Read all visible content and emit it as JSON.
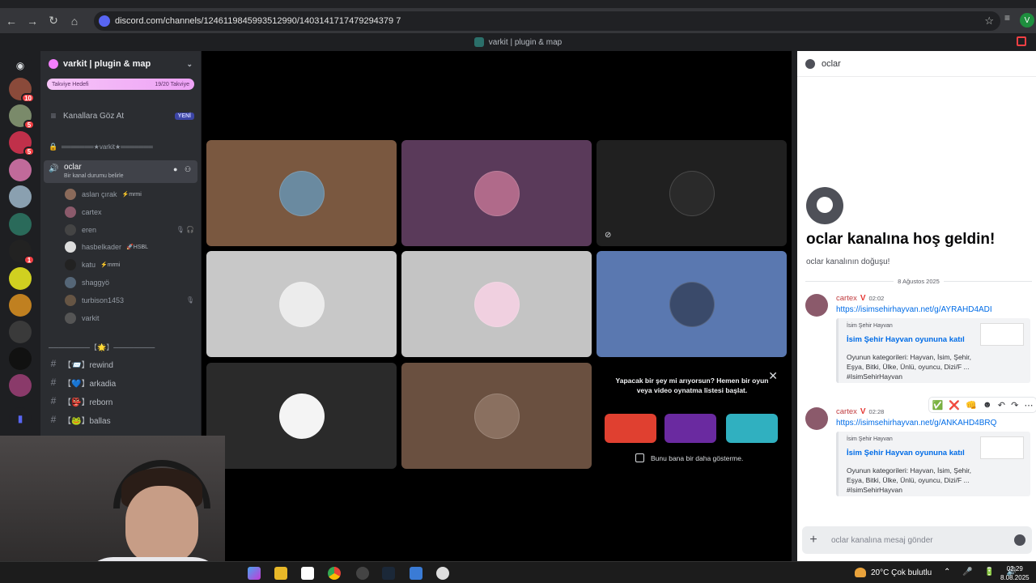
{
  "browser": {
    "url": "discord.com/channels/1246119845993512990/1403141717479294379 7",
    "window_title": "varkit | plugin & map",
    "profile_initial": "V"
  },
  "servers": [
    {
      "badge": "10",
      "color": "#8a4a3a"
    },
    {
      "badge": "5",
      "color": "#7a8a6a"
    },
    {
      "badge": "5",
      "color": "#c0304a"
    },
    {
      "badge": "",
      "color": "#c06a9a"
    },
    {
      "badge": "",
      "color": "#8aa0b0"
    },
    {
      "badge": "",
      "color": "#2a6a5a"
    },
    {
      "badge": "1",
      "color": "#222222"
    },
    {
      "badge": "",
      "color": "#d0d020"
    },
    {
      "badge": "",
      "color": "#c08020"
    },
    {
      "badge": "",
      "color": "#3a3a3a"
    },
    {
      "badge": "",
      "color": "#111111"
    },
    {
      "badge": "",
      "color": "#8a3a6a"
    }
  ],
  "sidebar": {
    "server_name": "varkit | plugin & map",
    "boost_goal": "Takviye Hedefi",
    "boost_count": "19/20 Takviye",
    "browse_channels": "Kanallara Göz At",
    "new_tag": "YENİ",
    "locked_sep": "═══════★varkit★═══════",
    "voice_channel": "oclar",
    "voice_status": "Bir kanal durumu belirle",
    "members": [
      {
        "name": "aslan çırak",
        "tag": "⚡mrmi",
        "color": "#8a6a5a",
        "mute": ""
      },
      {
        "name": "cartex",
        "tag": "",
        "color": "#8b5a6b",
        "mute": ""
      },
      {
        "name": "eren",
        "tag": "",
        "color": "#444444",
        "mute": "🎙 🎧"
      },
      {
        "name": "hasbelkader",
        "tag": "🚀HSBL",
        "color": "#dddddd",
        "mute": ""
      },
      {
        "name": "katu",
        "tag": "⚡mrmi",
        "color": "#222222",
        "mute": ""
      },
      {
        "name": "shaggyö",
        "tag": "",
        "color": "#556677",
        "mute": ""
      },
      {
        "name": "turbison1453",
        "tag": "",
        "color": "#665544",
        "mute": "🎙"
      },
      {
        "name": "varkit",
        "tag": "",
        "color": "#555555",
        "mute": ""
      }
    ],
    "category": "────────【🌟】────────",
    "text_channels": [
      {
        "name": "【📨】rewind"
      },
      {
        "name": "【💙】arkadia"
      },
      {
        "name": "【👺】reborn"
      },
      {
        "name": "【🐸】ballas"
      }
    ]
  },
  "stage": {
    "tiles": [
      {
        "bg": "#7a5840",
        "av": "#6a8aa0"
      },
      {
        "bg": "#5a3a5a",
        "av": "#b06a8a"
      },
      {
        "bg": "#202020",
        "av": "#2a2a2a",
        "video_off": true
      },
      {
        "bg": "#c8c8c8",
        "av": "#ececec"
      },
      {
        "bg": "#c4c4c4",
        "av": "#f0d0e0"
      },
      {
        "bg": "#5a78b0",
        "av": "#3a4a6a"
      },
      {
        "bg": "#2a2a2a",
        "av": "#f4f4f4"
      },
      {
        "bg": "#6a5040",
        "av": "#8a7060"
      }
    ],
    "promo": {
      "title": "Yapacak bir şey mi arıyorsun? Hemen bir oyun veya video oynatma listesi başlat.",
      "dont_show": "Bunu bana bir daha gösterme.",
      "games": [
        "#e04030",
        "#6a2aa0",
        "#30b0c0"
      ]
    }
  },
  "chat": {
    "channel": "oclar",
    "welcome_title": "oclar kanalına hoş geldin!",
    "welcome_sub": "oclar kanalının doğuşu!",
    "date": "8 Ağustos 2025",
    "messages": [
      {
        "author": "cartex",
        "badge": "V",
        "time": "02:02",
        "link": "https://isimsehirhayvan.net/g/AYRAHD4ADI",
        "embed": {
          "provider": "İsim Şehir Hayvan",
          "title": "İsim Şehir Hayvan oyununa katıl",
          "desc": "Oyunun kategorileri: Hayvan, İsim, Şehir, Eşya, Bitki, Ülke, Ünlü, oyuncu, Dizi/F ... #IsimSehirHayvan"
        }
      },
      {
        "author": "cartex",
        "badge": "V",
        "time": "02:28",
        "link": "https://isimsehirhayvan.net/g/ANKAHD4BRQ",
        "embed": {
          "provider": "İsim Şehir Hayvan",
          "title": "İsim Şehir Hayvan oyununa katıl",
          "desc": "Oyunun kategorileri: Hayvan, İsim, Şehir, Eşya, Bitki, Ülke, Ünlü, oyuncu, Dizi/F ... #IsimSehirHayvan"
        }
      }
    ],
    "actions": [
      "✅",
      "❌",
      "👊",
      "☻",
      "↶",
      "↷",
      "⋯"
    ],
    "composer_placeholder": "oclar kanalına mesaj gönder"
  },
  "taskbar": {
    "weather": "20°C  Çok bulutlu",
    "tray": "⌃ 🎤 🔋 🔊",
    "time": "02:29",
    "date": "8.08.2025"
  }
}
